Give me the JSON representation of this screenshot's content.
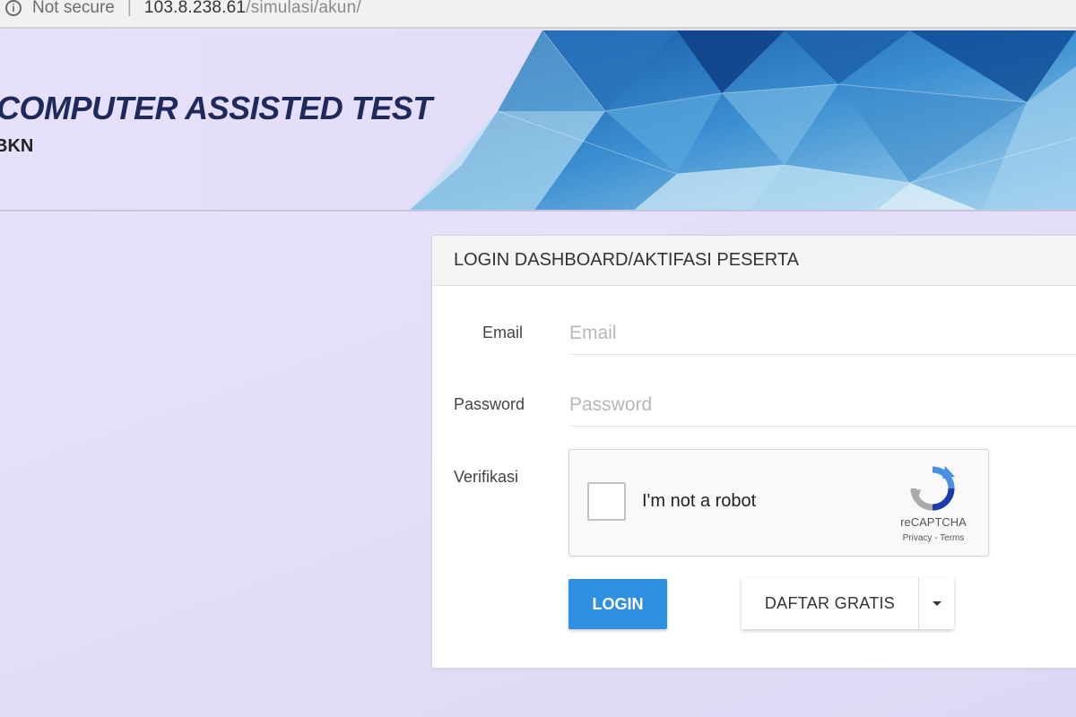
{
  "browser": {
    "security_label": "Not secure",
    "separator": "|",
    "url_host": "103.8.238.61",
    "url_path": "/simulasi/akun/"
  },
  "header": {
    "title": "COMPUTER ASSISTED TEST",
    "subtitle": "BKN"
  },
  "login_panel": {
    "heading": "LOGIN DASHBOARD/AKTIFASI PESERTA",
    "email": {
      "label": "Email",
      "placeholder": "Email",
      "value": ""
    },
    "password": {
      "label": "Password",
      "placeholder": "Password",
      "value": ""
    },
    "verification": {
      "label": "Verifikasi",
      "captcha_text": "I'm not a robot",
      "captcha_brand": "reCAPTCHA",
      "captcha_links": "Privacy - Terms"
    },
    "login_button": "LOGIN",
    "register_button": "DAFTAR GRATIS"
  },
  "colors": {
    "primary_button": "#2f8fe0",
    "title_text": "#1f2a5c",
    "background": "#e6e0fb"
  }
}
